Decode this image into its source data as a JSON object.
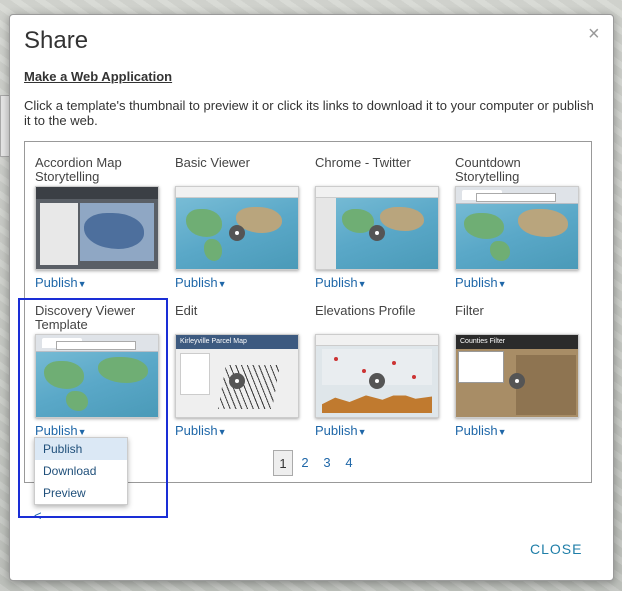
{
  "dialog": {
    "title": "Share",
    "close_icon": "×",
    "subtitle": "Make a Web Application",
    "description": "Click a template's thumbnail to preview it or click its links to download it to your computer or publish it to the web.",
    "close_button": "CLOSE",
    "back_arrow": "<"
  },
  "templates": [
    {
      "title": "Accordion Map Storytelling",
      "publish": "Publish",
      "thumb": "accordion-map"
    },
    {
      "title": "Basic Viewer",
      "publish": "Publish",
      "thumb": "basic-viewer"
    },
    {
      "title": "Chrome - Twitter",
      "publish": "Publish",
      "thumb": "chrome-twitter"
    },
    {
      "title": "Countdown Storytelling",
      "publish": "Publish",
      "thumb": "countdown"
    },
    {
      "title": "Discovery Viewer Template",
      "publish": "Publish",
      "thumb": "discovery-viewer"
    },
    {
      "title": "Edit",
      "publish": "Publish",
      "thumb": "edit",
      "thumb_label": "Kirleyville Parcel Map"
    },
    {
      "title": "Elevations Profile",
      "publish": "Publish",
      "thumb": "elevations-profile"
    },
    {
      "title": "Filter",
      "publish": "Publish",
      "thumb": "filter",
      "thumb_label": "Counties Filter"
    }
  ],
  "pagination": {
    "pages": [
      "1",
      "2",
      "3",
      "4"
    ],
    "current": "1"
  },
  "publish_menu": {
    "items": [
      "Publish",
      "Download",
      "Preview"
    ],
    "selected": "Publish"
  },
  "colors": {
    "link": "#1f67a8",
    "highlight_border": "#1a2ed6",
    "close_button": "#1f7ea8"
  }
}
